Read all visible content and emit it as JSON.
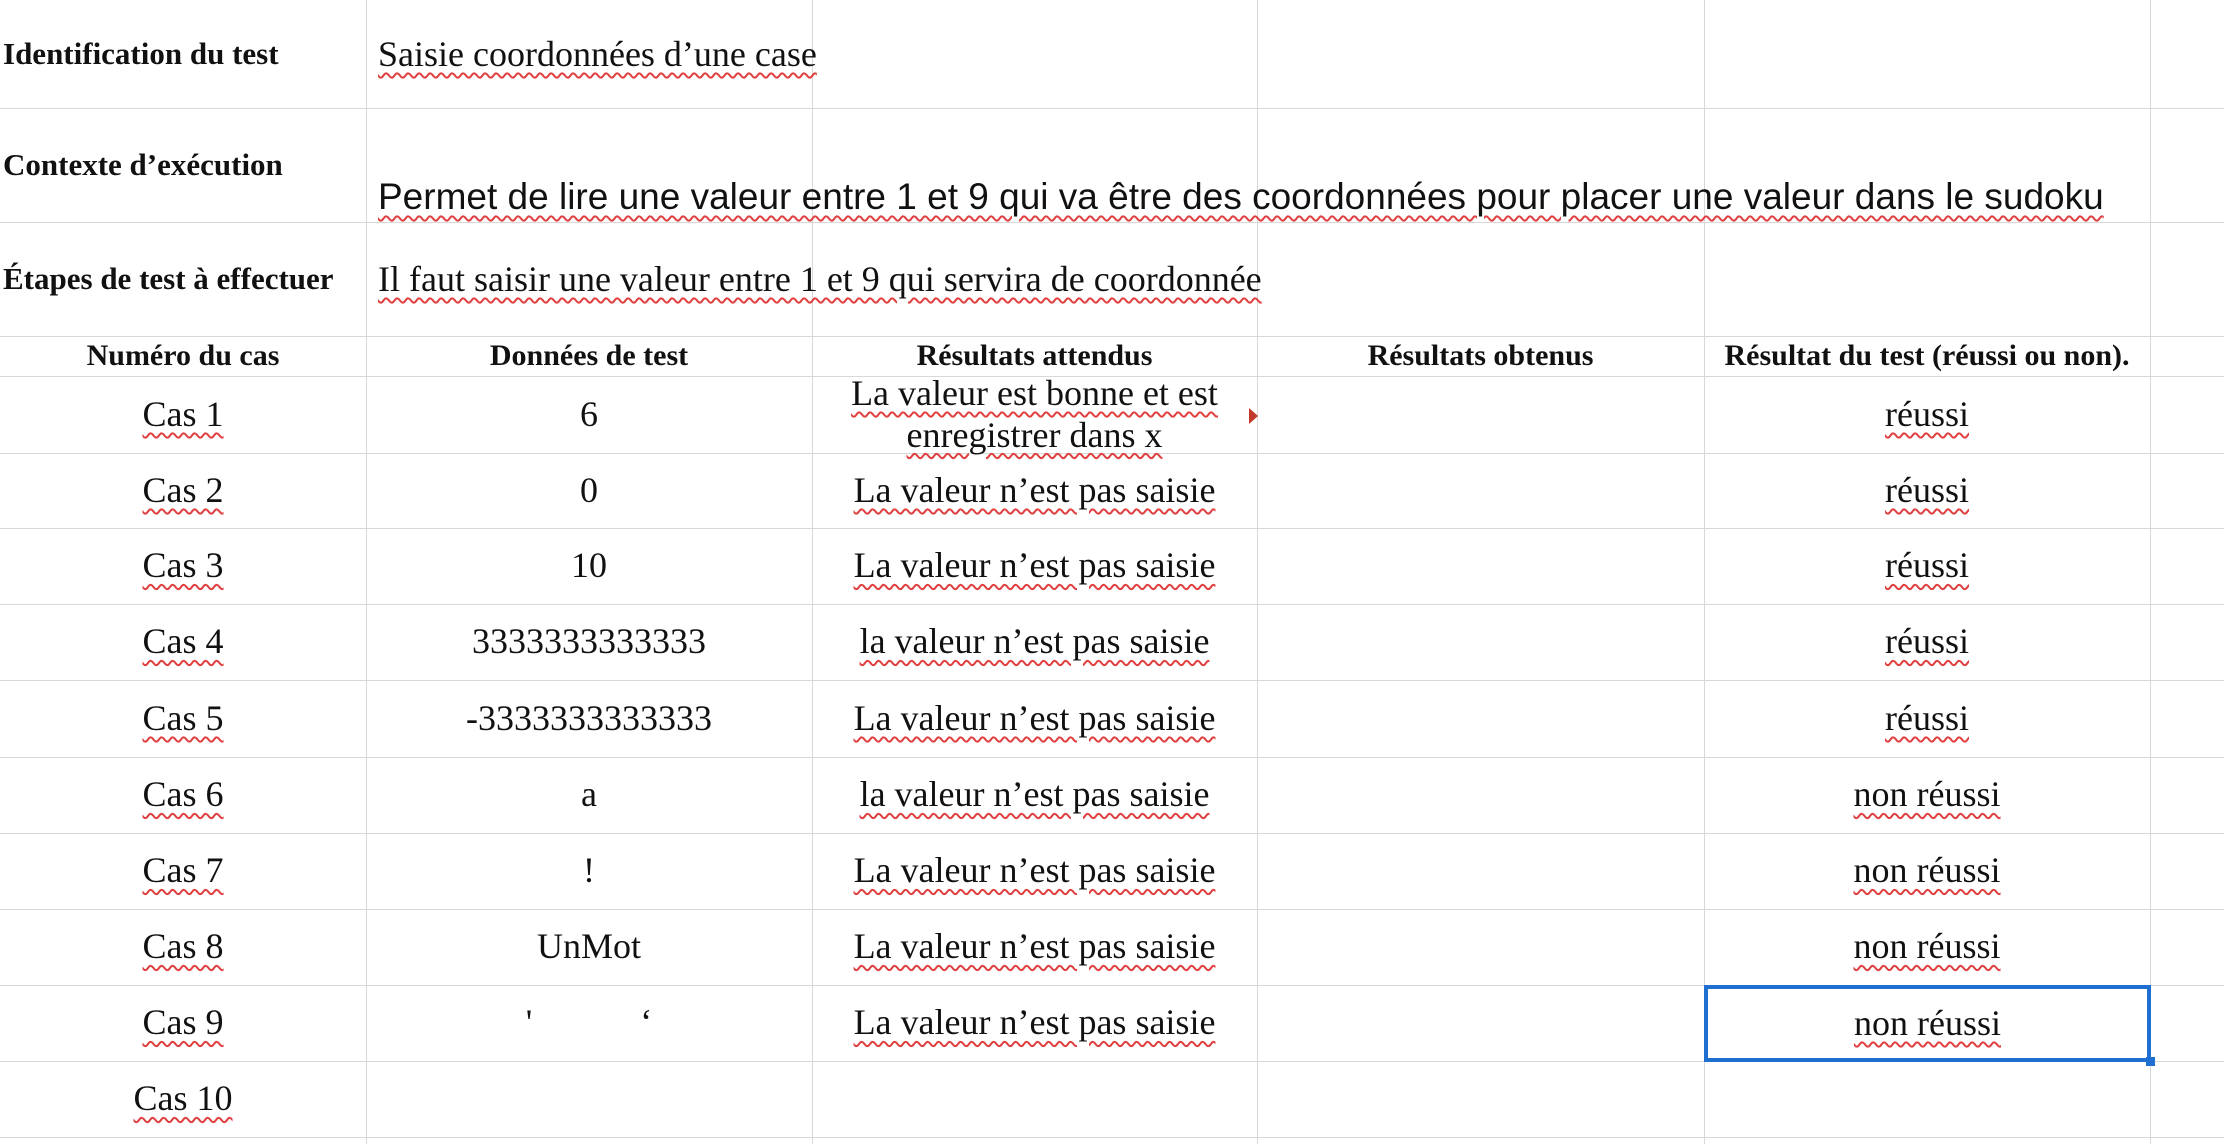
{
  "header_info": {
    "identification_label": "Identification du test",
    "identification_value": "Saisie coordonnées d’une case",
    "contexte_label": "Contexte d’exécution",
    "contexte_value": "Permet de lire une valeur entre 1 et 9 qui va être des coordonnées pour placer une valeur dans le sudoku",
    "etapes_label": "Étapes de test à effectuer",
    "etapes_value": "Il faut saisir une valeur entre 1 et 9 qui servira de coordonnée"
  },
  "table": {
    "columns": [
      "Numéro du cas",
      "Données de test",
      "Résultats attendus",
      "Résultats obtenus",
      "Résultat du test (réussi ou non)."
    ],
    "rows": [
      {
        "cas": "Cas 1",
        "donnees": "6",
        "attendus": "La valeur est bonne et est enregistrer dans x",
        "obtenus": "",
        "resultat": "réussi"
      },
      {
        "cas": "Cas 2",
        "donnees": "0",
        "attendus": "La valeur n’est pas saisie",
        "obtenus": "",
        "resultat": "réussi"
      },
      {
        "cas": "Cas 3",
        "donnees": "10",
        "attendus": "La valeur n’est pas saisie",
        "obtenus": "",
        "resultat": "réussi"
      },
      {
        "cas": "Cas 4",
        "donnees": "3333333333333",
        "attendus": "la valeur n’est pas saisie",
        "obtenus": "",
        "resultat": "réussi"
      },
      {
        "cas": "Cas 5",
        "donnees": "-3333333333333",
        "attendus": "La valeur n’est pas saisie",
        "obtenus": "",
        "resultat": "réussi"
      },
      {
        "cas": "Cas 6",
        "donnees": "a",
        "attendus": "la valeur n’est pas saisie",
        "obtenus": "",
        "resultat": "non réussi"
      },
      {
        "cas": "Cas 7",
        "donnees": "!",
        "attendus": "La valeur n’est pas saisie",
        "obtenus": "",
        "resultat": "non réussi"
      },
      {
        "cas": "Cas 8",
        "donnees": "UnMot",
        "attendus": "La valeur n’est pas saisie",
        "obtenus": "",
        "resultat": "non réussi"
      },
      {
        "cas": "Cas 9",
        "donnees": "'            ‘",
        "attendus": "La valeur n’est pas saisie",
        "obtenus": "",
        "resultat": "non réussi"
      },
      {
        "cas": "Cas 10",
        "donnees": "",
        "attendus": "",
        "obtenus": "",
        "resultat": ""
      }
    ]
  },
  "colors": {
    "grid": "#d8d8d8",
    "selection": "#1e6fd0",
    "spellcheck": "#e04040",
    "comment_marker": "#c0392b"
  }
}
